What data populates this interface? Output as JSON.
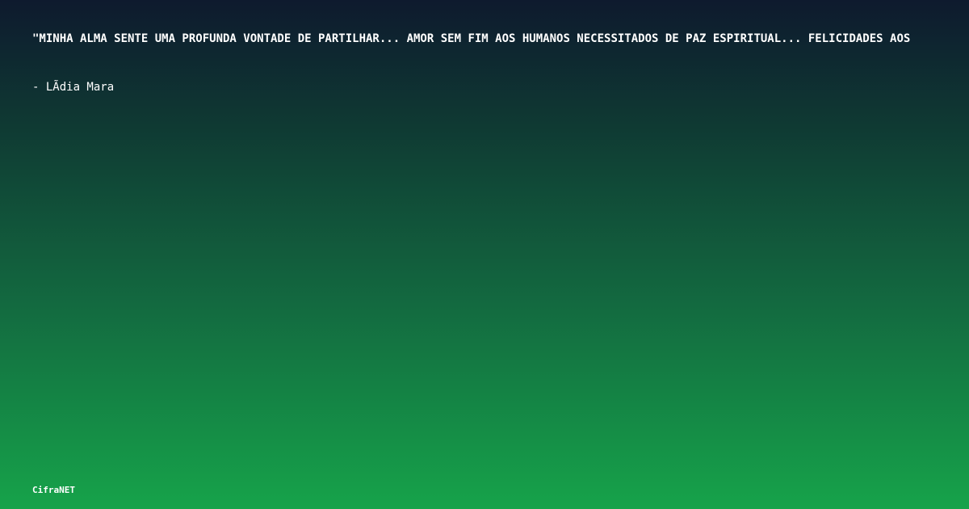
{
  "quote": {
    "text": "\"MINHA ALMA SENTE UMA PROFUNDA VONTADE DE PARTILHAR... AMOR SEM FIM AOS HUMANOS NECESSITADOS DE PAZ ESPIRITUAL... FELICIDADES AOS"
  },
  "author": {
    "text": "- LÃ­dia Mara"
  },
  "brand": {
    "name": "CifraNET"
  },
  "colors": {
    "top": "#0e1a2e",
    "bottom": "#16a34a",
    "text": "#ffffff"
  }
}
